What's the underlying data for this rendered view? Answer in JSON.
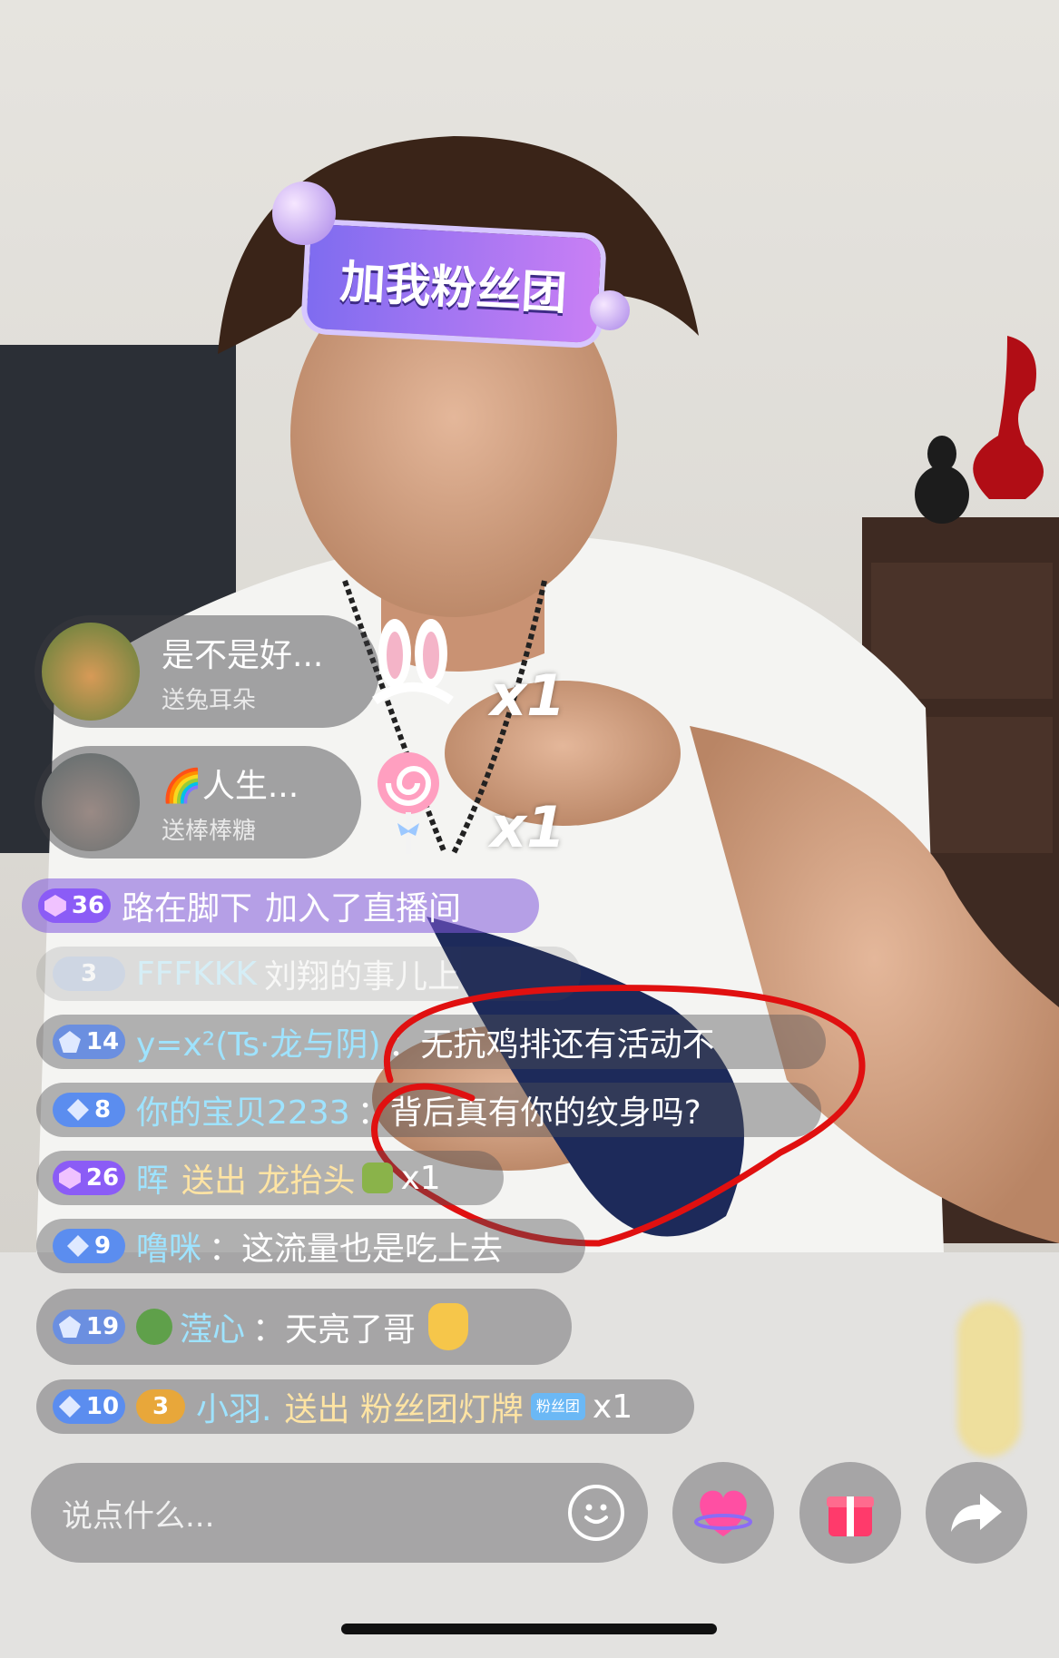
{
  "banner": {
    "text": "加我粉丝团"
  },
  "gifts": [
    {
      "user": "是不是好...",
      "action": "送兔耳朵",
      "count": "x1"
    },
    {
      "user": "🌈人生...",
      "action": "送棒棒糖",
      "count": "x1"
    }
  ],
  "join_message": {
    "level": "36",
    "user": "路在脚下",
    "text": "加入了直播间"
  },
  "faded_message": {
    "level": "3",
    "user": "FFFKKK",
    "text": "刘翔的事儿上"
  },
  "comments": [
    {
      "level": "14",
      "user": "y=x²(Ts·龙与阴)",
      "sep": "：",
      "text": "无抗鸡排还有活动不"
    },
    {
      "level": "8",
      "user": "你的宝贝2233",
      "sep": "：",
      "text": "背后真有你的纹身吗?"
    }
  ],
  "gift_message": {
    "level": "26",
    "user": "晖",
    "text": "送出 龙抬头",
    "count": "x1"
  },
  "comment3": {
    "level": "9",
    "user": "噜咪",
    "sep": "：",
    "text": "这流量也是吃上去"
  },
  "comment4": {
    "level": "19",
    "user": "滢心",
    "sep": "：",
    "text": "天亮了哥"
  },
  "fan_message": {
    "level": "10",
    "badge": "3",
    "user": "小羽.",
    "text": "送出 粉丝团灯牌",
    "badge_text": "粉丝团",
    "count": "x1"
  },
  "input": {
    "placeholder": "说点什么..."
  },
  "colors": {
    "purple_badge": "#8b5cf6",
    "blue_badge": "#5b8def",
    "annotation_red": "#e01010"
  }
}
